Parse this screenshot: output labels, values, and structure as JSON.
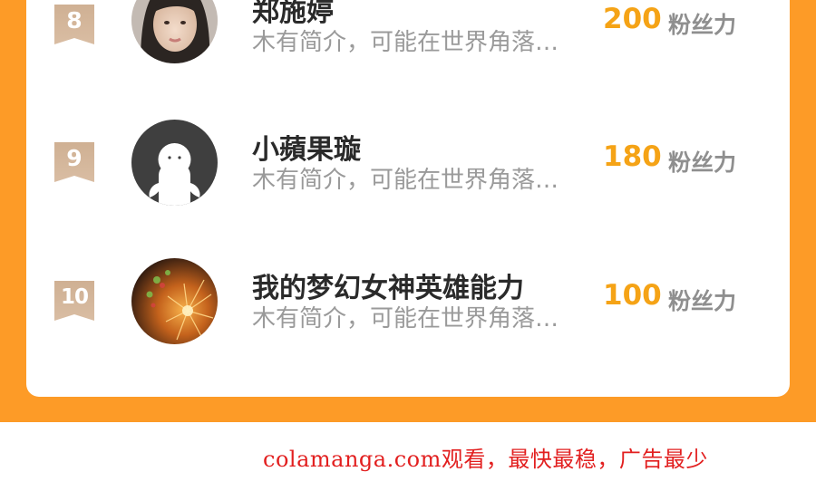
{
  "ranking": {
    "rows": [
      {
        "rank": "8",
        "name": "郑施婷",
        "intro": "木有简介，可能在世界角落…",
        "score": "200",
        "unit": "粉丝力"
      },
      {
        "rank": "9",
        "name": "小蘋果璇",
        "intro": "木有简介，可能在世界角落…",
        "score": "180",
        "unit": "粉丝力"
      },
      {
        "rank": "10",
        "name": "我的梦幻女神英雄能力",
        "intro": "木有简介，可能在世界角落…",
        "score": "100",
        "unit": "粉丝力"
      }
    ]
  },
  "watermark": "colamanga.com观看，最快最稳，广告最少",
  "colors": {
    "frame": "#fd9b27",
    "score": "#f5a316",
    "rank_flag": "#cfb093",
    "watermark": "#e21f1f"
  },
  "icons": {
    "rank_badge": "bookmark-ribbon-icon",
    "default_avatar": "ghost-default-avatar-icon"
  }
}
